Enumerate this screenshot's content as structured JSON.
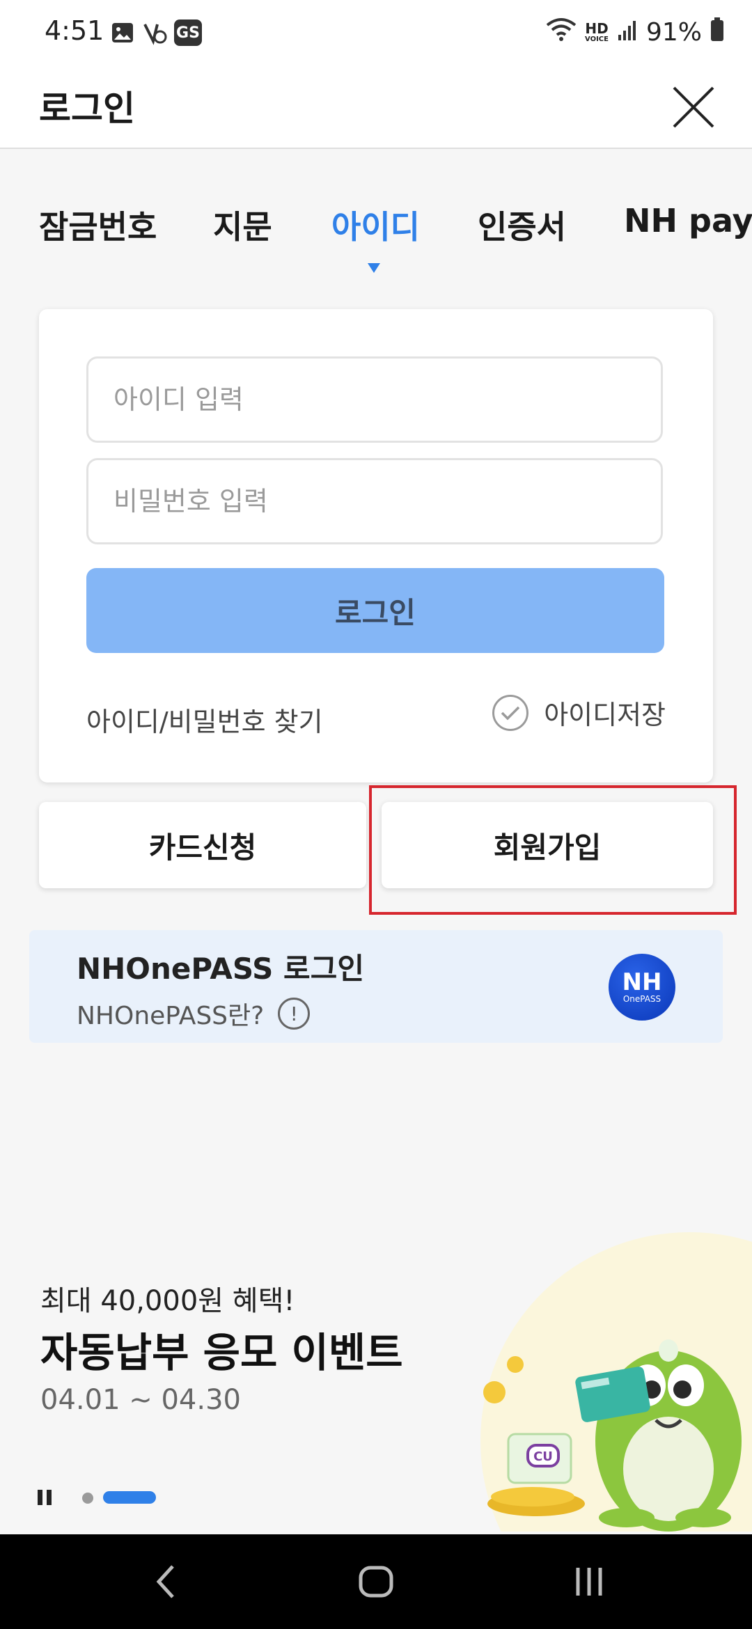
{
  "status_bar": {
    "time": "4:51",
    "battery": "91%",
    "hd_top": "HD",
    "hd_bottom": "VOICE",
    "gs_badge": "GS",
    "icons": [
      "image-icon",
      "sync-icon",
      "gs-app-icon",
      "wifi-icon",
      "hd-voice-icon",
      "signal-icon",
      "battery-icon"
    ]
  },
  "app_bar": {
    "title": "로그인",
    "close_icon": "close-icon"
  },
  "tabs": [
    {
      "label": "잠금번호",
      "active": false
    },
    {
      "label": "지문",
      "active": false
    },
    {
      "label": "아이디",
      "active": true
    },
    {
      "label": "인증서",
      "active": false
    },
    {
      "label": "NH pay",
      "active": false
    }
  ],
  "login_form": {
    "id_placeholder": "아이디 입력",
    "id_value": "",
    "password_placeholder": "비밀번호 입력",
    "password_value": "",
    "login_button": "로그인",
    "find_link": "아이디/비밀번호 찾기",
    "save_id_label": "아이디저장",
    "save_id_checked": false
  },
  "actions": {
    "card_apply": "카드신청",
    "sign_up": "회원가입"
  },
  "onepass": {
    "title": "NHOnePASS 로그인",
    "subtitle": "NHOnePASS란?",
    "info_symbol": "!",
    "logo_text": "NH",
    "logo_sub": "OnePASS"
  },
  "banner": {
    "subtitle": "최대 40,000원 혜택!",
    "title": "자동납부 응모 이벤트",
    "date": "04.01 ~ 04.30",
    "art_labels": {
      "cu": "CU"
    }
  },
  "colors": {
    "accent": "#2f80e8",
    "login_button_bg": "#84b6f6",
    "highlight": "#d6262e",
    "onepass_bg": "#e9f1fb"
  }
}
